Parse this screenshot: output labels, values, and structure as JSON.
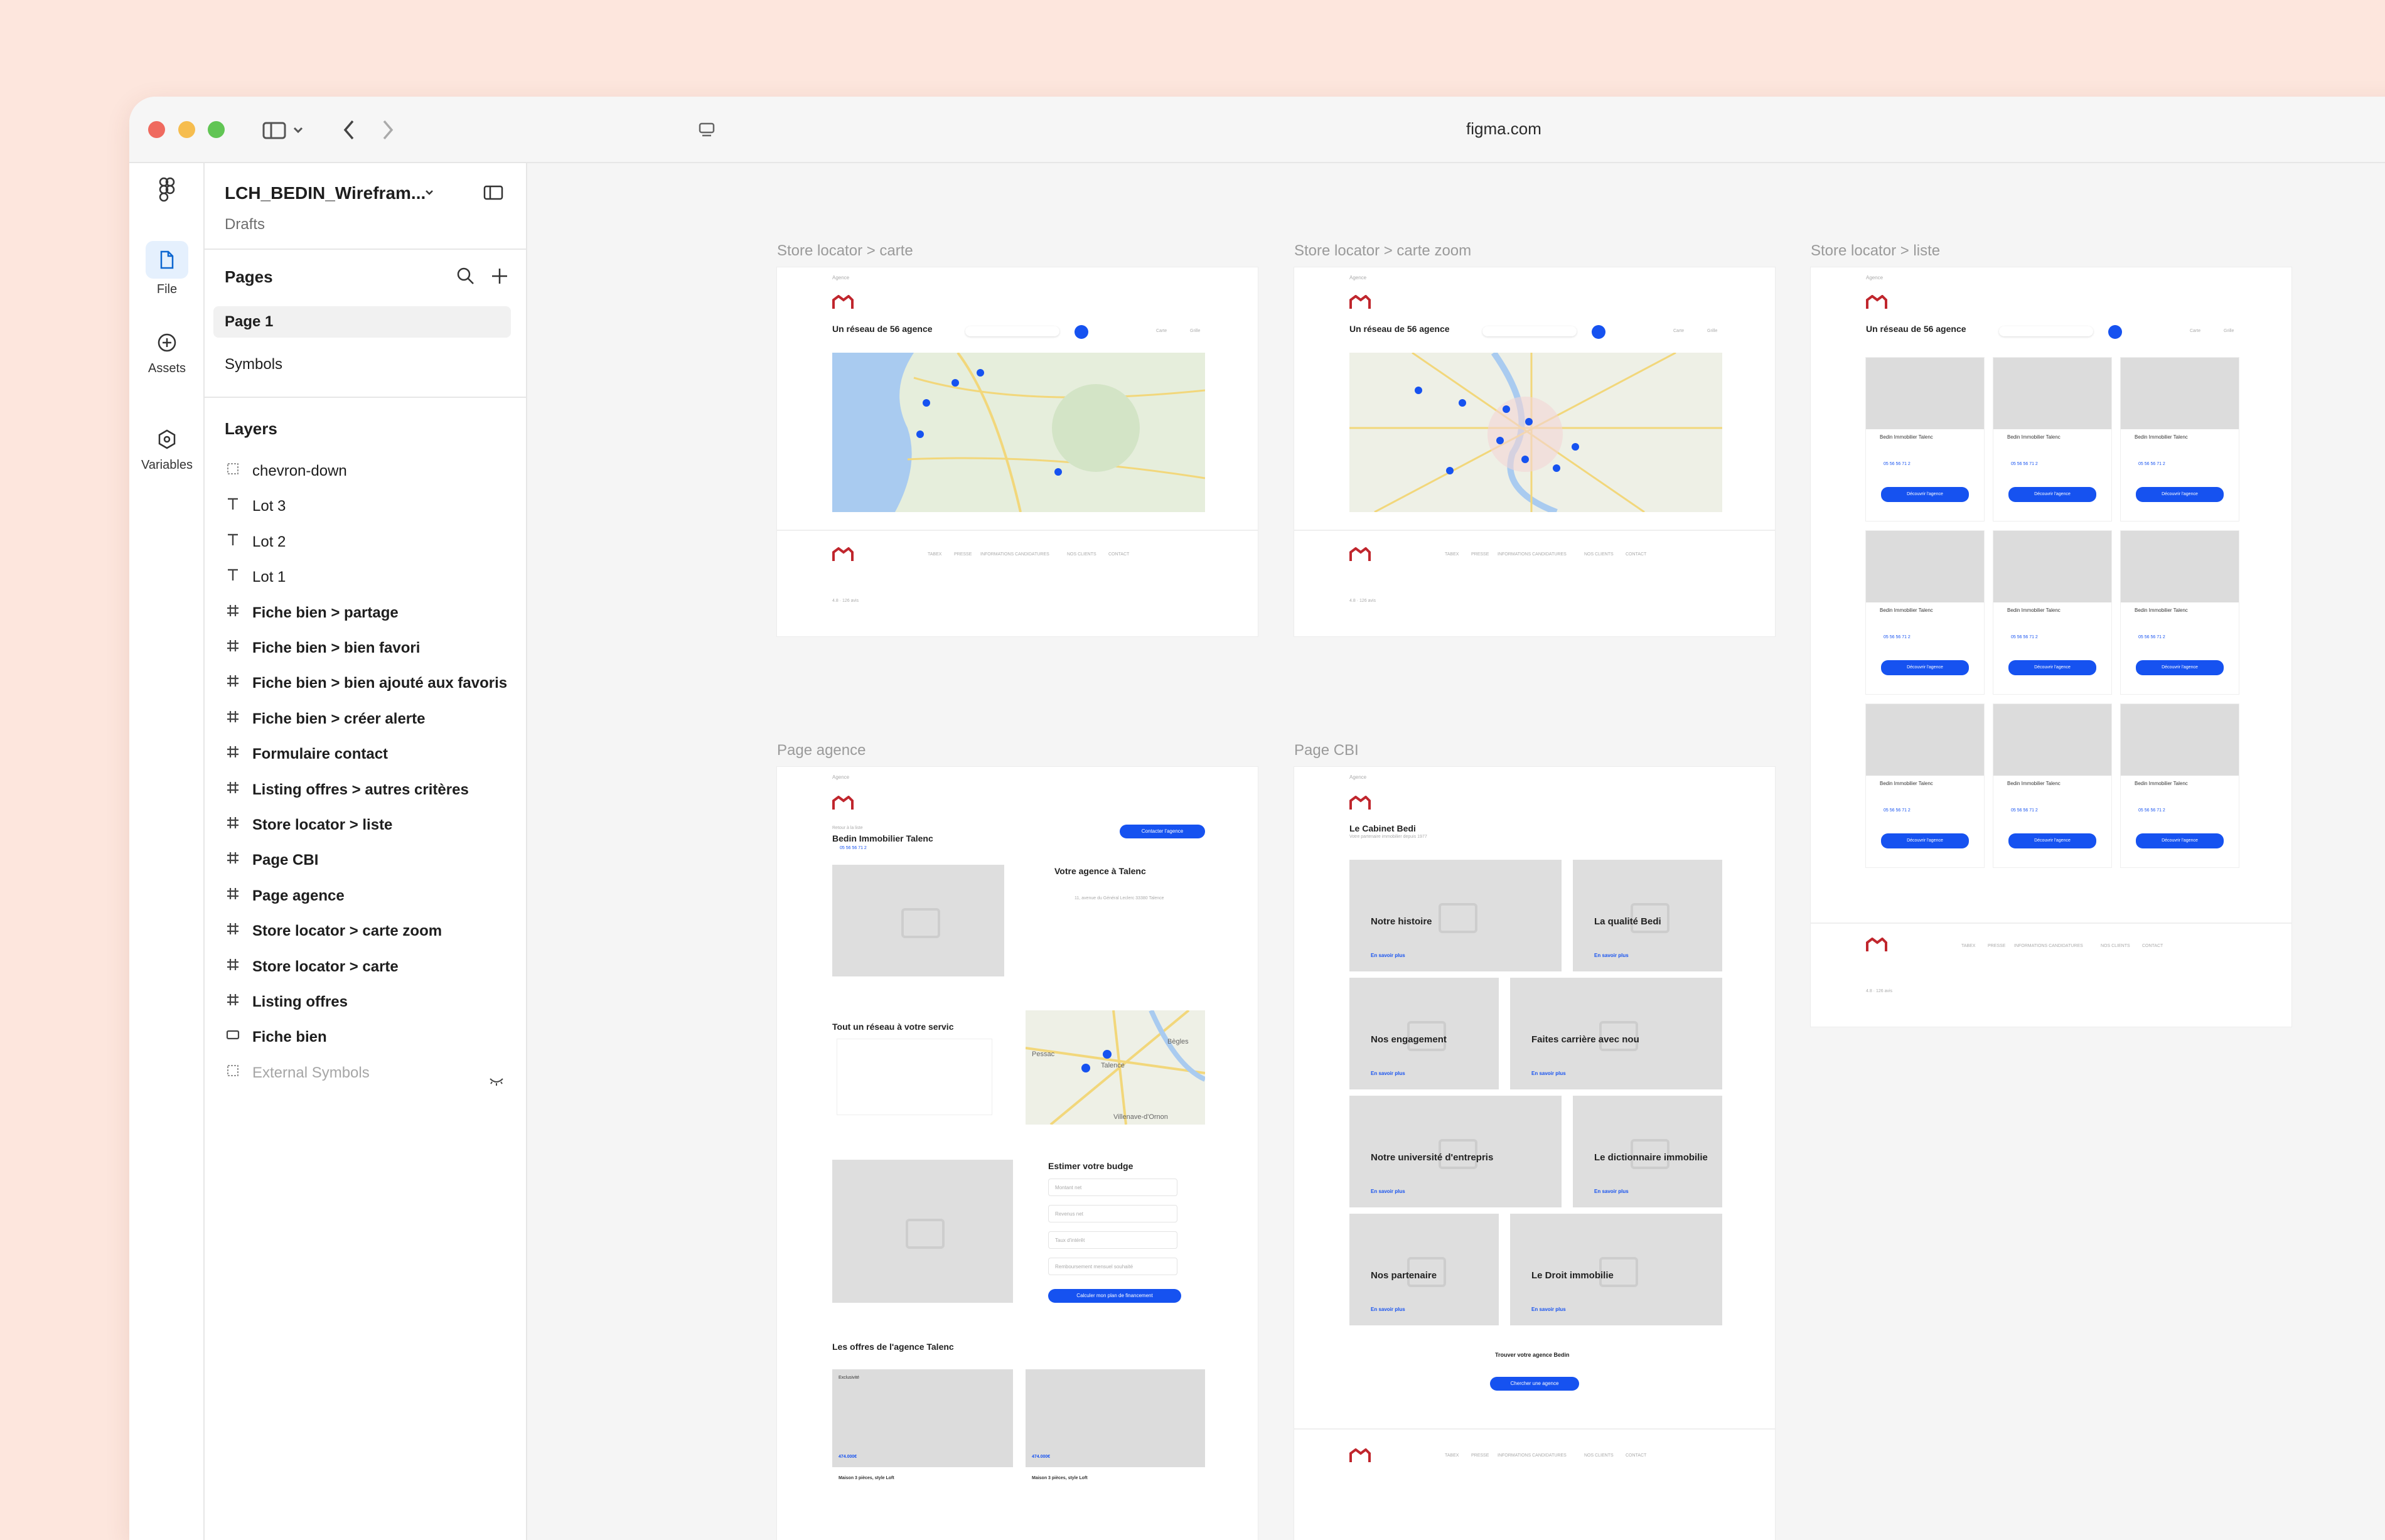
{
  "browser": {
    "url": "figma.com"
  },
  "rail": {
    "file_label": "File",
    "assets_label": "Assets",
    "variables_label": "Variables"
  },
  "file": {
    "title": "LCH_BEDIN_Wirefram...",
    "location": "Drafts"
  },
  "pages": {
    "heading": "Pages",
    "items": [
      {
        "label": "Page 1",
        "selected": true
      },
      {
        "label": "Symbols",
        "selected": false
      }
    ]
  },
  "layers": {
    "heading": "Layers",
    "items": [
      {
        "label": "chevron-down",
        "icon": "component-dashed-icon"
      },
      {
        "label": "Lot 3",
        "icon": "text-icon"
      },
      {
        "label": "Lot 2",
        "icon": "text-icon"
      },
      {
        "label": "Lot 1",
        "icon": "text-icon"
      },
      {
        "label": "Fiche bien > partage",
        "icon": "frame-icon"
      },
      {
        "label": "Fiche bien > bien favori",
        "icon": "frame-icon"
      },
      {
        "label": "Fiche bien > bien ajouté aux favoris",
        "icon": "frame-icon"
      },
      {
        "label": "Fiche bien > créer alerte",
        "icon": "frame-icon"
      },
      {
        "label": "Formulaire contact",
        "icon": "frame-icon"
      },
      {
        "label": "Listing offres > autres critères",
        "icon": "frame-icon"
      },
      {
        "label": "Store locator > liste",
        "icon": "frame-icon"
      },
      {
        "label": "Page CBI",
        "icon": "frame-icon"
      },
      {
        "label": "Page agence",
        "icon": "frame-icon"
      },
      {
        "label": "Store locator > carte zoom",
        "icon": "frame-icon"
      },
      {
        "label": "Store locator > carte",
        "icon": "frame-icon"
      },
      {
        "label": "Listing offres",
        "icon": "frame-icon"
      },
      {
        "label": "Fiche bien",
        "icon": "section-icon"
      },
      {
        "label": "External Symbols",
        "icon": "component-dashed-icon"
      }
    ]
  },
  "canvas": {
    "frames": {
      "carte": "Store locator > carte",
      "carte_zoom": "Store locator > carte zoom",
      "liste": "Store locator > liste",
      "agence": "Page agence",
      "cbi": "Page CBI"
    },
    "store": {
      "heading": "Un réseau de 56 agence",
      "search_placeholder": "Code postal, ville, département",
      "view_map": "Carte",
      "view_grid": "Grille",
      "nav": [
        "Agence",
        "Localité",
        "Mes conseils"
      ],
      "card_title": "Bedin Immobilier Talenc",
      "card_phone": "05 56 56 71 2",
      "card_button": "Découvrir l'agence"
    },
    "footer": {
      "nav": [
        "TABEX",
        "PRESSE",
        "INFORMATIONS CANDIDATURES",
        "NOS CLIENTS",
        "CONTACT"
      ],
      "rating": "4.8 · 126 avis"
    },
    "agence": {
      "breadcrumb": "Retour à la liste",
      "name": "Bedin Immobilier Talenc",
      "phone": "05 56 56 71 2",
      "contact_btn": "Contacter l'agence",
      "info_title": "Votre agence à Talenc",
      "address": "11, avenue du Général Leclerc 33380 Talence",
      "network_title": "Tout un réseau à votre servic",
      "budget_title": "Estimer votre budge",
      "budget_fields": [
        "Montant net",
        "Revenus net",
        "Taux d'intérêt",
        "Remboursement mensuel souhaité"
      ],
      "budget_btn": "Calculer mon plan de financement",
      "offers_title": "Les offres de l'agence Talenc",
      "offer_tag": "Exclusivité",
      "offer_price_1": "474.000€",
      "offer_price_2": "474.000€",
      "offer_title": "Maison 3 pièces, style Loft",
      "map_labels": [
        "Pessac",
        "Bègles",
        "Talence",
        "Villenave-d'Ornon"
      ]
    },
    "cbi": {
      "title": "Le Cabinet Bedi",
      "subtitle": "Votre partenaire immobilier depuis 1977",
      "blocks": [
        "Notre histoire",
        "La qualité Bedi",
        "Nos engagement",
        "Faites carrière avec nou",
        "Notre université d'entrepris",
        "Le dictionnaire immobilie",
        "Nos partenaire",
        "Le Droit immobilie"
      ],
      "link": "En savoir plus",
      "find_title": "Trouver votre agence Bedin",
      "find_btn": "Chercher une agence"
    }
  }
}
